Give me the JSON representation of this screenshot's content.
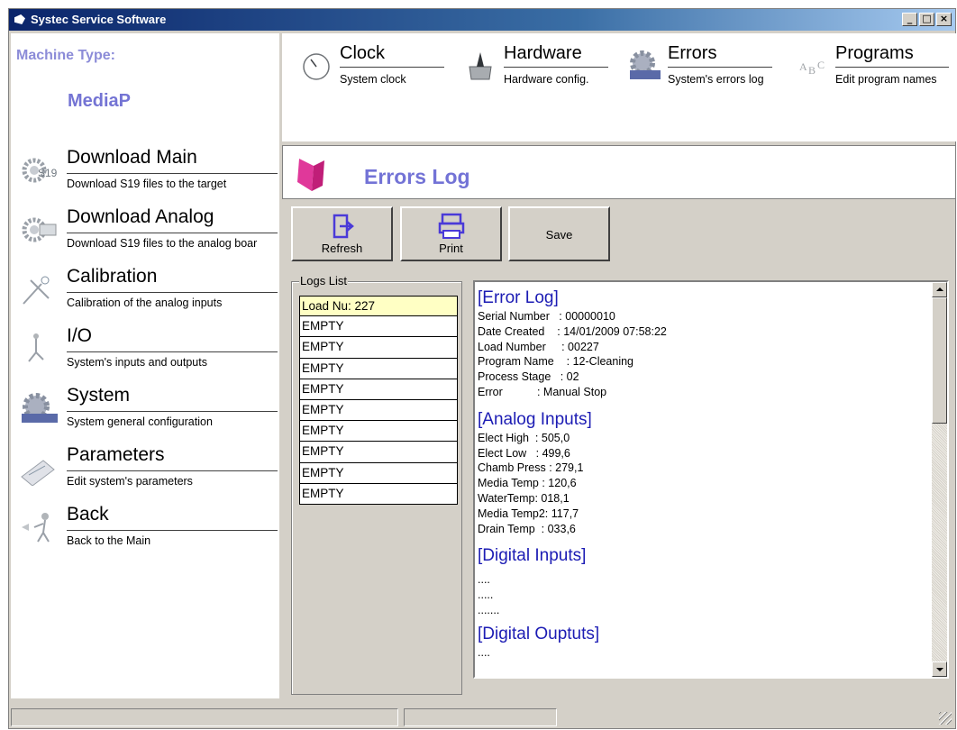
{
  "window": {
    "title": "Systec Service Software",
    "min": "_",
    "max": "□",
    "close": "×"
  },
  "sidebar": {
    "machine_type_label": "Machine Type:",
    "machine_type_value": "MediaP",
    "items": [
      {
        "title": "Download Main",
        "desc": "Download S19 files to the target",
        "icon": "gear-download-icon"
      },
      {
        "title": "Download Analog",
        "desc": "Download S19 files to the analog boar",
        "icon": "gear-analog-icon"
      },
      {
        "title": "Calibration",
        "desc": "Calibration of the analog inputs",
        "icon": "calibration-icon"
      },
      {
        "title": "I/O",
        "desc": "System's inputs and outputs",
        "icon": "io-icon"
      },
      {
        "title": "System",
        "desc": "System general configuration",
        "icon": "system-gear-icon"
      },
      {
        "title": "Parameters",
        "desc": "Edit system's parameters",
        "icon": "parameters-icon"
      },
      {
        "title": "Back",
        "desc": "Back to the Main",
        "icon": "back-icon"
      }
    ]
  },
  "toolbar": {
    "items": [
      {
        "title": "Clock",
        "desc": "System clock",
        "icon": "clock-icon"
      },
      {
        "title": "Hardware",
        "desc": "Hardware config.",
        "icon": "hardware-icon"
      },
      {
        "title": "Errors",
        "desc": "System's errors log",
        "icon": "errors-gear-icon"
      },
      {
        "title": "Programs",
        "desc": "Edit program names",
        "icon": "programs-icon"
      }
    ]
  },
  "page": {
    "title": "Errors Log"
  },
  "actions": {
    "refresh": "Refresh",
    "print": "Print",
    "save": "Save"
  },
  "logs": {
    "legend": "Logs List",
    "items": [
      "Load Nu: 227",
      "EMPTY",
      "EMPTY",
      "EMPTY",
      "EMPTY",
      "EMPTY",
      "EMPTY",
      "EMPTY",
      "EMPTY",
      "EMPTY"
    ]
  },
  "log": {
    "error_log": {
      "heading": "[Error Log]",
      "rows": [
        {
          "k": "Serial Number   :",
          "v": " 00000010"
        },
        {
          "k": "Date Created    :",
          "v": " 14/01/2009 07:58:22"
        },
        {
          "k": "Load Number     :",
          "v": " 00227"
        },
        {
          "k": "Program Name    :",
          "v": " 12-Cleaning"
        },
        {
          "k": "Process Stage   :",
          "v": " 02"
        },
        {
          "k": "Error           :",
          "v": " Manual Stop"
        }
      ]
    },
    "analog_inputs": {
      "heading": "[Analog Inputs]",
      "rows": [
        {
          "k": "Elect High  :",
          "v": " 505,0"
        },
        {
          "k": "Elect Low   :",
          "v": " 499,6"
        },
        {
          "k": "Chamb Press :",
          "v": " 279,1"
        },
        {
          "k": "Media Temp :",
          "v": " 120,6"
        },
        {
          "k": "WaterTemp:",
          "v": " 018,1"
        },
        {
          "k": "Media Temp2:",
          "v": " 117,7"
        },
        {
          "k": "Drain Temp  :",
          "v": " 033,6"
        }
      ]
    },
    "digital_inputs": {
      "heading": "[Digital Inputs]",
      "lines": [
        "....",
        ".....",
        "......."
      ]
    },
    "digital_outputs": {
      "heading": "[Digital Ouptuts]",
      "lines": [
        "...."
      ]
    }
  }
}
